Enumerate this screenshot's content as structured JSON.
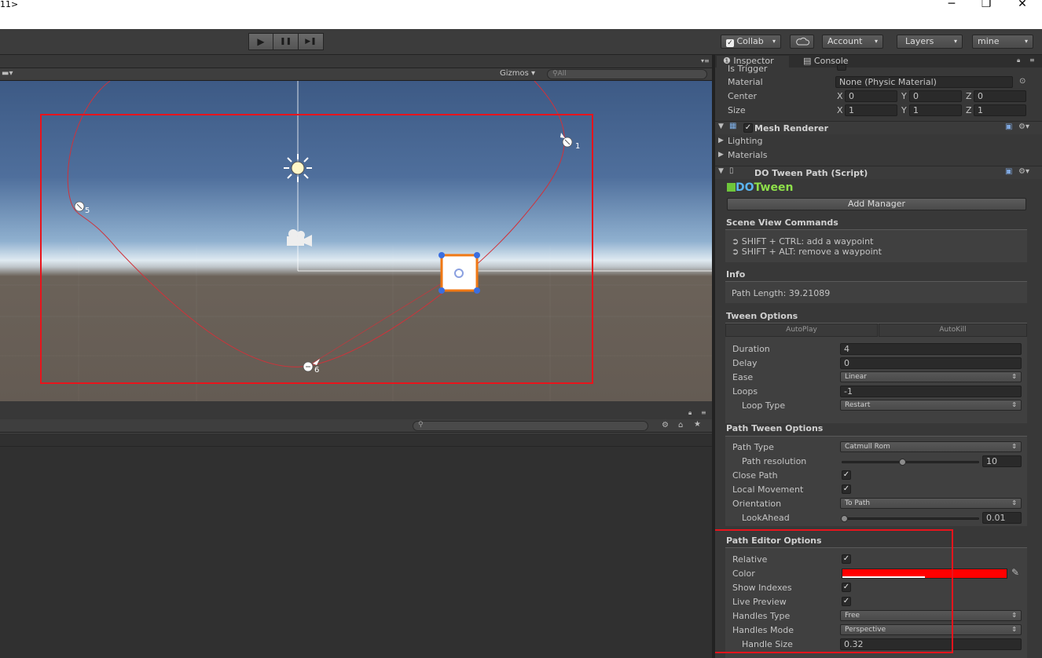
{
  "window": {
    "title": "11>",
    "minimize": "─",
    "maximize": "❐",
    "close": "✕"
  },
  "toolbar": {
    "play_icon": "▶",
    "pause_icon": "❚❚",
    "step_icon": "▶❚",
    "collab_label": "Collab",
    "account_label": "Account",
    "layers_label": "Layers",
    "layout_label": "mine"
  },
  "scene": {
    "gizmos_label": "Gizmos",
    "search_placeholder": "All",
    "waypoint_labels": [
      "1",
      "5",
      "6"
    ]
  },
  "inspector": {
    "tab_inspector": "Inspector",
    "tab_console": "Console",
    "collider": {
      "is_trigger_label": "Is Trigger",
      "material_label": "Material",
      "material_value": "None (Physic Material)",
      "center_label": "Center",
      "center": {
        "x": "0",
        "y": "0",
        "z": "0"
      },
      "size_label": "Size",
      "size": {
        "x": "1",
        "y": "1",
        "z": "1"
      },
      "axis_x": "X",
      "axis_y": "Y",
      "axis_z": "Z"
    },
    "mesh_renderer": {
      "title": "Mesh Renderer",
      "lighting": "Lighting",
      "materials": "Materials"
    },
    "dotween": {
      "title": "DO Tween Path (Script)",
      "logo_do": "DO",
      "logo_tween": "Tween",
      "add_manager": "Add Manager",
      "scene_view_commands_title": "Scene View Commands",
      "cmd_add": "➲ SHIFT + CTRL: add a waypoint",
      "cmd_remove": "➲ SHIFT + ALT: remove a waypoint",
      "info_title": "Info",
      "path_length": "Path Length: 39.21089",
      "tween_options_title": "Tween Options",
      "autoplay": "AutoPlay",
      "autokill": "AutoKill",
      "duration_label": "Duration",
      "duration": "4",
      "delay_label": "Delay",
      "delay": "0",
      "ease_label": "Ease",
      "ease": "Linear",
      "loops_label": "Loops",
      "loops": "-1",
      "loop_type_label": "Loop Type",
      "loop_type": "Restart",
      "path_tween_title": "Path Tween Options",
      "path_type_label": "Path Type",
      "path_type": "Catmull Rom",
      "path_resolution_label": "Path resolution",
      "path_resolution": "10",
      "close_path_label": "Close Path",
      "local_movement_label": "Local Movement",
      "orientation_label": "Orientation",
      "orientation": "To Path",
      "lookahead_label": "LookAhead",
      "lookahead": "0.01",
      "path_editor_title": "Path Editor Options",
      "relative_label": "Relative",
      "color_label": "Color",
      "path_color": "#ff0000",
      "show_indexes_label": "Show Indexes",
      "live_preview_label": "Live Preview",
      "handles_type_label": "Handles Type",
      "handles_type": "Free",
      "handles_mode_label": "Handles Mode",
      "handles_mode": "Perspective",
      "handle_size_label": "Handle Size",
      "handle_size": "0.32"
    }
  },
  "colors": {
    "highlight": "#e8141c",
    "path": "#d0323a",
    "selection": "#f07814",
    "handle": "#3a6ee0"
  }
}
